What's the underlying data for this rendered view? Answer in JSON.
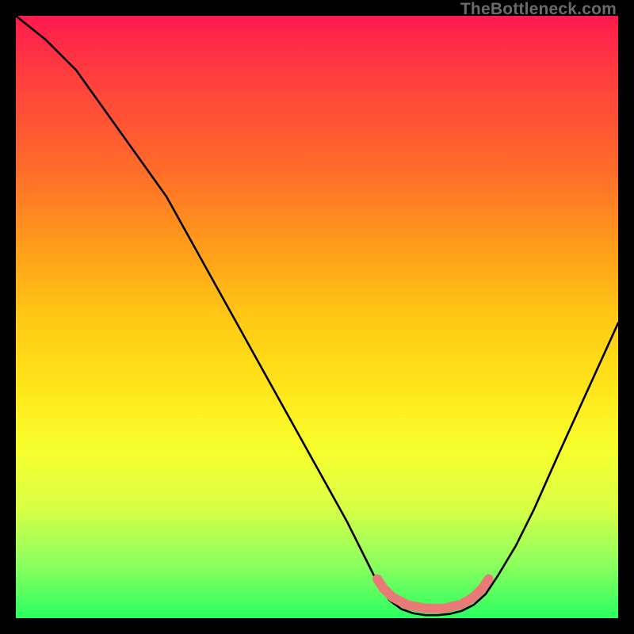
{
  "watermark": "TheBottleneck.com",
  "chart_data": {
    "type": "line",
    "title": "",
    "xlabel": "",
    "ylabel": "",
    "xlim": [
      0,
      100
    ],
    "ylim": [
      0,
      100
    ],
    "grid": false,
    "line": [
      {
        "x": 0,
        "y": 100
      },
      {
        "x": 5,
        "y": 96
      },
      {
        "x": 10,
        "y": 91
      },
      {
        "x": 15,
        "y": 84
      },
      {
        "x": 20,
        "y": 77
      },
      {
        "x": 25,
        "y": 70
      },
      {
        "x": 30,
        "y": 61
      },
      {
        "x": 35,
        "y": 52
      },
      {
        "x": 40,
        "y": 43
      },
      {
        "x": 45,
        "y": 34
      },
      {
        "x": 50,
        "y": 25
      },
      {
        "x": 55,
        "y": 16
      },
      {
        "x": 58,
        "y": 10
      },
      {
        "x": 60,
        "y": 6
      },
      {
        "x": 62,
        "y": 3
      },
      {
        "x": 64,
        "y": 1.5
      },
      {
        "x": 66,
        "y": 0.8
      },
      {
        "x": 68,
        "y": 0.5
      },
      {
        "x": 70,
        "y": 0.5
      },
      {
        "x": 72,
        "y": 0.7
      },
      {
        "x": 74,
        "y": 1.2
      },
      {
        "x": 76,
        "y": 2.2
      },
      {
        "x": 78,
        "y": 4
      },
      {
        "x": 80,
        "y": 7
      },
      {
        "x": 83,
        "y": 12
      },
      {
        "x": 86,
        "y": 18
      },
      {
        "x": 90,
        "y": 27
      },
      {
        "x": 95,
        "y": 38
      },
      {
        "x": 100,
        "y": 49
      }
    ],
    "highlight_segment": [
      {
        "x": 60,
        "y": 6.5
      },
      {
        "x": 61,
        "y": 5.0
      },
      {
        "x": 62.5,
        "y": 3.5
      },
      {
        "x": 65,
        "y": 2.2
      },
      {
        "x": 68,
        "y": 1.6
      },
      {
        "x": 71,
        "y": 1.6
      },
      {
        "x": 74,
        "y": 2.3
      },
      {
        "x": 76,
        "y": 3.5
      },
      {
        "x": 77.5,
        "y": 5.0
      },
      {
        "x": 78.5,
        "y": 6.5
      }
    ],
    "colors": {
      "line": "#000000",
      "highlight": "#e97a77",
      "gradient_top": "#ff1a4d",
      "gradient_bottom": "#2aff60"
    }
  }
}
